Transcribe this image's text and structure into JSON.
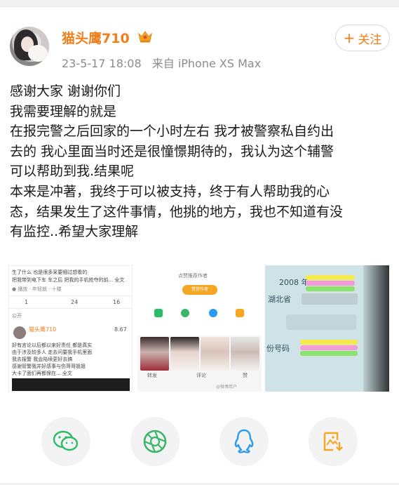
{
  "post": {
    "author": "猫头鹰710",
    "timestamp": "23-5-17 18:08",
    "source": "来自 iPhone XS Max",
    "follow_label": "关注",
    "follow_plus": "+",
    "body_lines": [
      "感谢大家 谢谢你们",
      "我需要理解的就是",
      "在报完警之后回家的一个小时左右 我才被警察私自约出",
      "去的 我心里面当时还是很憧憬期待的，我认为这个辅警",
      "可以帮助到我.结果呢",
      "本来是冲著，我终于可以被支持，终于有人帮助我的心",
      "态，结果发生了这件事情，他挑的地方，我也不知道有没",
      "有监控..希望大家理解"
    ]
  },
  "thumbnails": {
    "t1": {
      "top_text_1": "生了什么 也是很多采要细过想看的",
      "top_text_2": "把我带到电下车 车之后 把我的手机抢夺的前... 全文",
      "meta": "● 播放 · 年轻就 · 十楼",
      "stat_repost": "1",
      "stat_comment": "24",
      "stat_like": "16",
      "tab": "公开",
      "name": "猫头鹰710",
      "count": "8.67",
      "lines": [
        "好有言论以后都以来好责任 都是真实",
        "由于涉及较多人 走去问要我手机里面",
        "我去报警 我会陆续更好去搞",
        "感谢管警我并好感事与伤哥哥姐姐",
        "大卡了面们再都保在... 全文"
      ]
    },
    "t2": {
      "header": "点赞推荐作者",
      "button": "赞赏作者",
      "repost": "转发",
      "comment": "评论",
      "like": "赞",
      "watermark": "@微博用户"
    },
    "t3": {
      "year": "2008 年",
      "province": "湖北省",
      "id_label": "份号码"
    }
  },
  "share": {
    "items": [
      "wechat-icon",
      "moments-icon",
      "qq-icon",
      "save-image-icon"
    ]
  },
  "colors": {
    "author": "#f07e1a",
    "meta": "#8c8c8c",
    "wechat": "#2cbb66",
    "moments": "#3ab56a",
    "qq": "#2d9bf0",
    "save": "#f5a623"
  }
}
